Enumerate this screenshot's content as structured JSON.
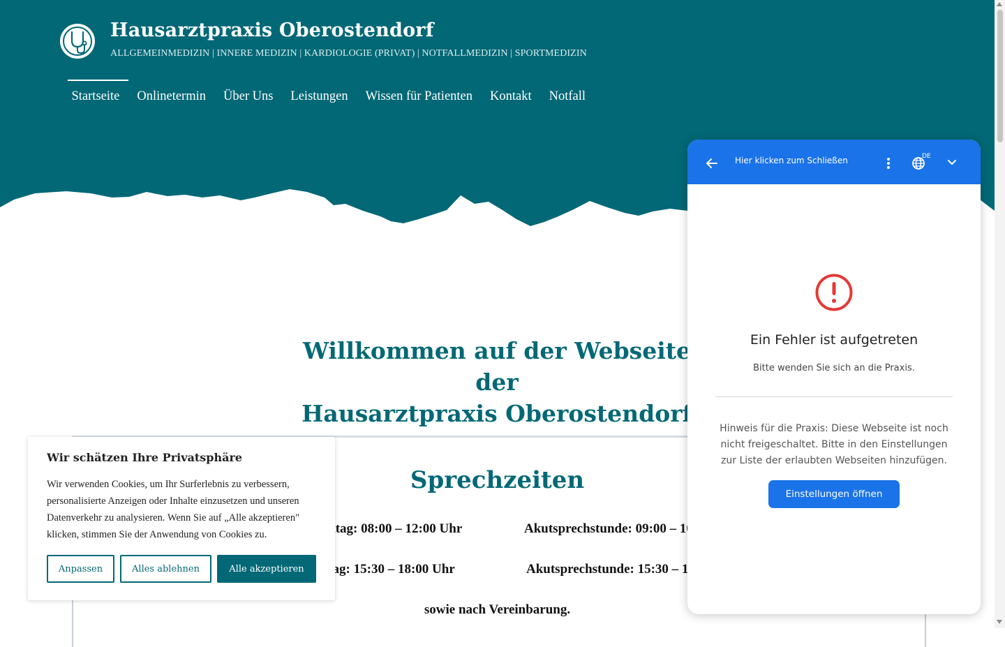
{
  "brand": {
    "title": "Hausarztpraxis Oberostendorf",
    "tagline": "ALLGEMEINMEDIZIN | INNERE MEDIZIN | KARDIOLOGIE (PRIVAT) | NOTFALLMEDIZIN | SPORTMEDIZIN",
    "logo_icon": "stethoscope-icon",
    "color": "#036876"
  },
  "nav": {
    "items": [
      {
        "label": "Startseite",
        "active": true
      },
      {
        "label": "Onlinetermin"
      },
      {
        "label": "Über Uns"
      },
      {
        "label": "Leistungen"
      },
      {
        "label": "Wissen für Patienten"
      },
      {
        "label": "Kontakt"
      },
      {
        "label": "Notfall"
      }
    ]
  },
  "main": {
    "welcome_line1": "Willkommen auf der Webseite der",
    "welcome_line2": "Hausarztpraxis Oberostendorf",
    "hours_title": "Sprechzeiten",
    "hours": {
      "row1_left": "Montag – Freitag: 08:00 – 12:00 Uhr",
      "row1_right": "Akutsprechstunde: 09:00 – 10:00 Uhr",
      "row2_left": "Montag, Dienstag: 15:30 – 18:00 Uhr",
      "row2_right": "Akutsprechstunde: 15:30 – 16:00 Uhr",
      "note": "sowie nach Vereinbarung."
    }
  },
  "cookie": {
    "title": "Wir schätzen Ihre Privatsphäre",
    "text": "Wir verwenden Cookies, um Ihr Surferlebnis zu verbessern, personalisierte Anzeigen oder Inhalte einzusetzen und unseren Datenverkehr zu analysieren. Wenn Sie auf „Alle akzeptieren\" klicken, stimmen Sie der Anwendung von Cookies zu.",
    "btn_customize": "Anpassen",
    "btn_reject": "Alles ablehnen",
    "btn_accept": "Alle akzeptieren"
  },
  "widget": {
    "header_title": "Hier klicken zum Schließen",
    "language": "DE",
    "error_title": "Ein Fehler ist aufgetreten",
    "error_sub": "Bitte wenden Sie sich an die Praxis.",
    "hint": "Hinweis für die Praxis: Diese Webseite ist noch nicht freigeschaltet. Bitte in den Einstellungen zur Liste der erlaubten Webseiten hinzufügen.",
    "button": "Einstellungen öffnen",
    "accent": "#1a73e8",
    "error_color": "#e53935"
  }
}
